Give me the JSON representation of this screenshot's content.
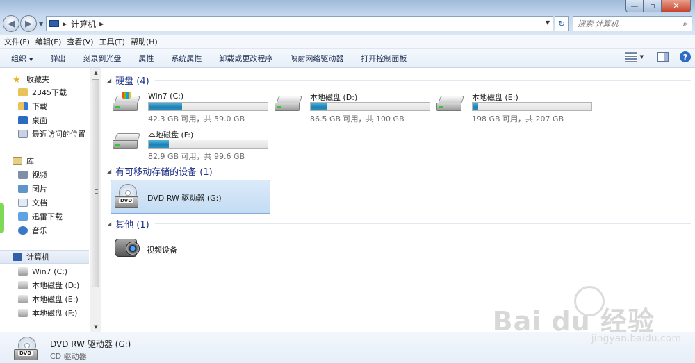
{
  "window": {
    "address_crumb": "计算机",
    "search_placeholder": "搜索 计算机"
  },
  "menu": [
    "文件(F)",
    "编辑(E)",
    "查看(V)",
    "工具(T)",
    "帮助(H)"
  ],
  "commands": {
    "organize": "组织",
    "eject": "弹出",
    "burn": "刻录到光盘",
    "properties": "属性",
    "system_properties": "系统属性",
    "uninstall": "卸载或更改程序",
    "map_drive": "映射网络驱动器",
    "control_panel": "打开控制面板"
  },
  "sidebar": {
    "favorites": "收藏夹",
    "fav_items": [
      "2345下载",
      "下载",
      "桌面",
      "最近访问的位置"
    ],
    "libraries": "库",
    "lib_items": [
      "视频",
      "图片",
      "文档",
      "迅雷下载",
      "音乐"
    ],
    "computer": "计算机",
    "drives": [
      "Win7 (C:)",
      "本地磁盘 (D:)",
      "本地磁盘 (E:)",
      "本地磁盘 (F:)"
    ]
  },
  "groups": {
    "hdd": "硬盘 (4)",
    "removable": "有可移动存储的设备 (1)",
    "other": "其他 (1)"
  },
  "drives": [
    {
      "name": "Win7 (C:)",
      "info": "42.3 GB 可用，共 59.0 GB",
      "used_fraction": 0.28
    },
    {
      "name": "本地磁盘 (D:)",
      "info": "86.5 GB 可用，共 100 GB",
      "used_fraction": 0.135
    },
    {
      "name": "本地磁盘 (E:)",
      "info": "198 GB 可用，共 207 GB",
      "used_fraction": 0.045
    },
    {
      "name": "本地磁盘 (F:)",
      "info": "82.9 GB 可用，共 99.6 GB",
      "used_fraction": 0.17
    }
  ],
  "dvd": {
    "name": "DVD RW 驱动器 (G:)",
    "label": "DVD"
  },
  "other_device": {
    "name": "视频设备"
  },
  "details": {
    "name": "DVD RW 驱动器 (G:)",
    "type": "CD 驱动器"
  },
  "watermark": {
    "text": "Bai du 经验",
    "url": "jingyan.baidu.com"
  },
  "colors": {
    "accent": "#1e3287",
    "bar_fill": "#2b93c6",
    "selection": "#c4dcf3"
  }
}
